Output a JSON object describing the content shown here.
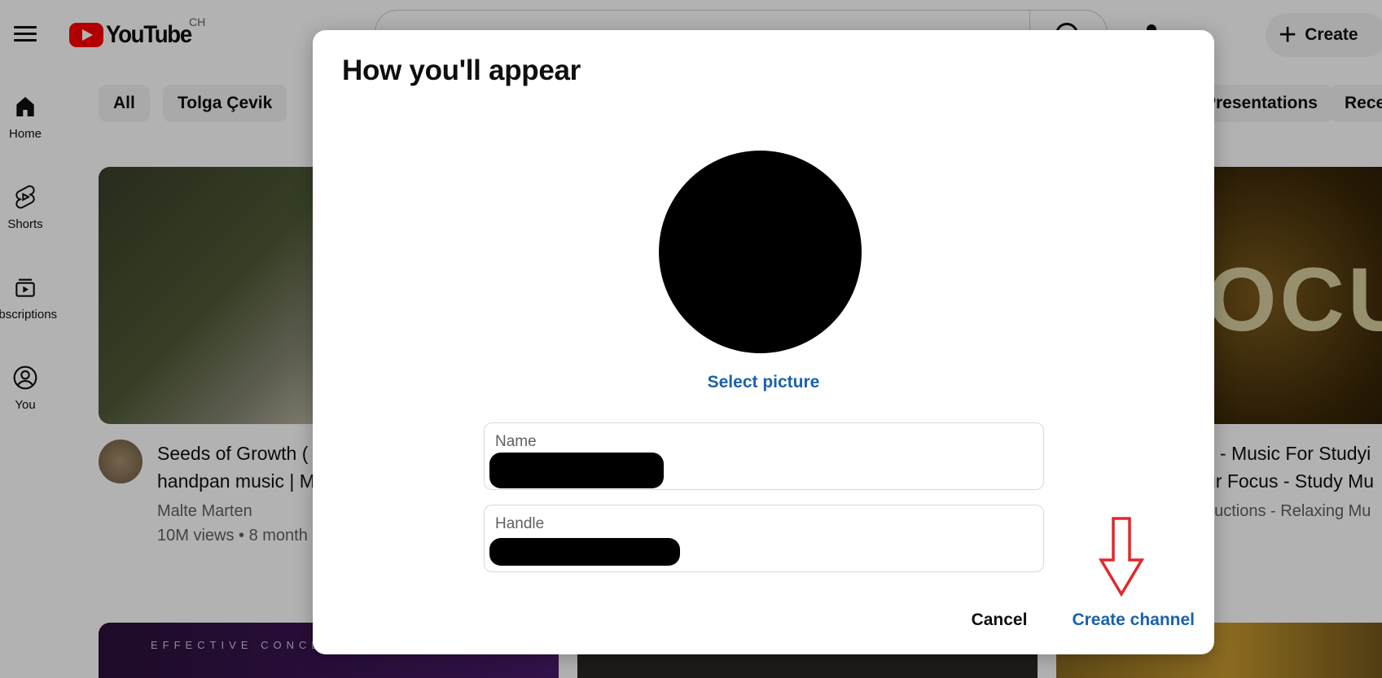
{
  "header": {
    "logo_text": "YouTube",
    "country_code": "CH",
    "create_label": "Create",
    "icons": [
      "menu-icon",
      "search-icon",
      "microphone-icon",
      "plus-icon"
    ]
  },
  "sidebar": {
    "items": [
      {
        "label": "Home",
        "icon": "home-icon"
      },
      {
        "label": "Shorts",
        "icon": "shorts-icon"
      },
      {
        "label": "Subscriptions",
        "icon": "subscriptions-icon"
      },
      {
        "label": "You",
        "icon": "you-icon"
      }
    ]
  },
  "chips": [
    "All",
    "Tolga Çevik",
    "Presentations",
    "Rece"
  ],
  "videos": [
    {
      "title_line1": "Seeds of Growth (",
      "title_line2": "handpan music | M",
      "channel": "Malte Marten",
      "meta": "10M views • 8 month"
    },
    {
      "title_line1": "s - Music For Studyi",
      "title_line2": "ur Focus - Study Mu",
      "channel": "ductions - Relaxing Mu",
      "meta": "",
      "thumbnail_text": "OCU"
    }
  ],
  "thumbnail_text_effective": "EFFECTIVE CONCE",
  "dialog": {
    "title": "How you'll appear",
    "select_picture": "Select picture",
    "name_label": "Name",
    "handle_label": "Handle",
    "cancel": "Cancel",
    "create_channel": "Create channel",
    "accent_color": "#1a62a8",
    "annotation_color": "#e0282e"
  }
}
